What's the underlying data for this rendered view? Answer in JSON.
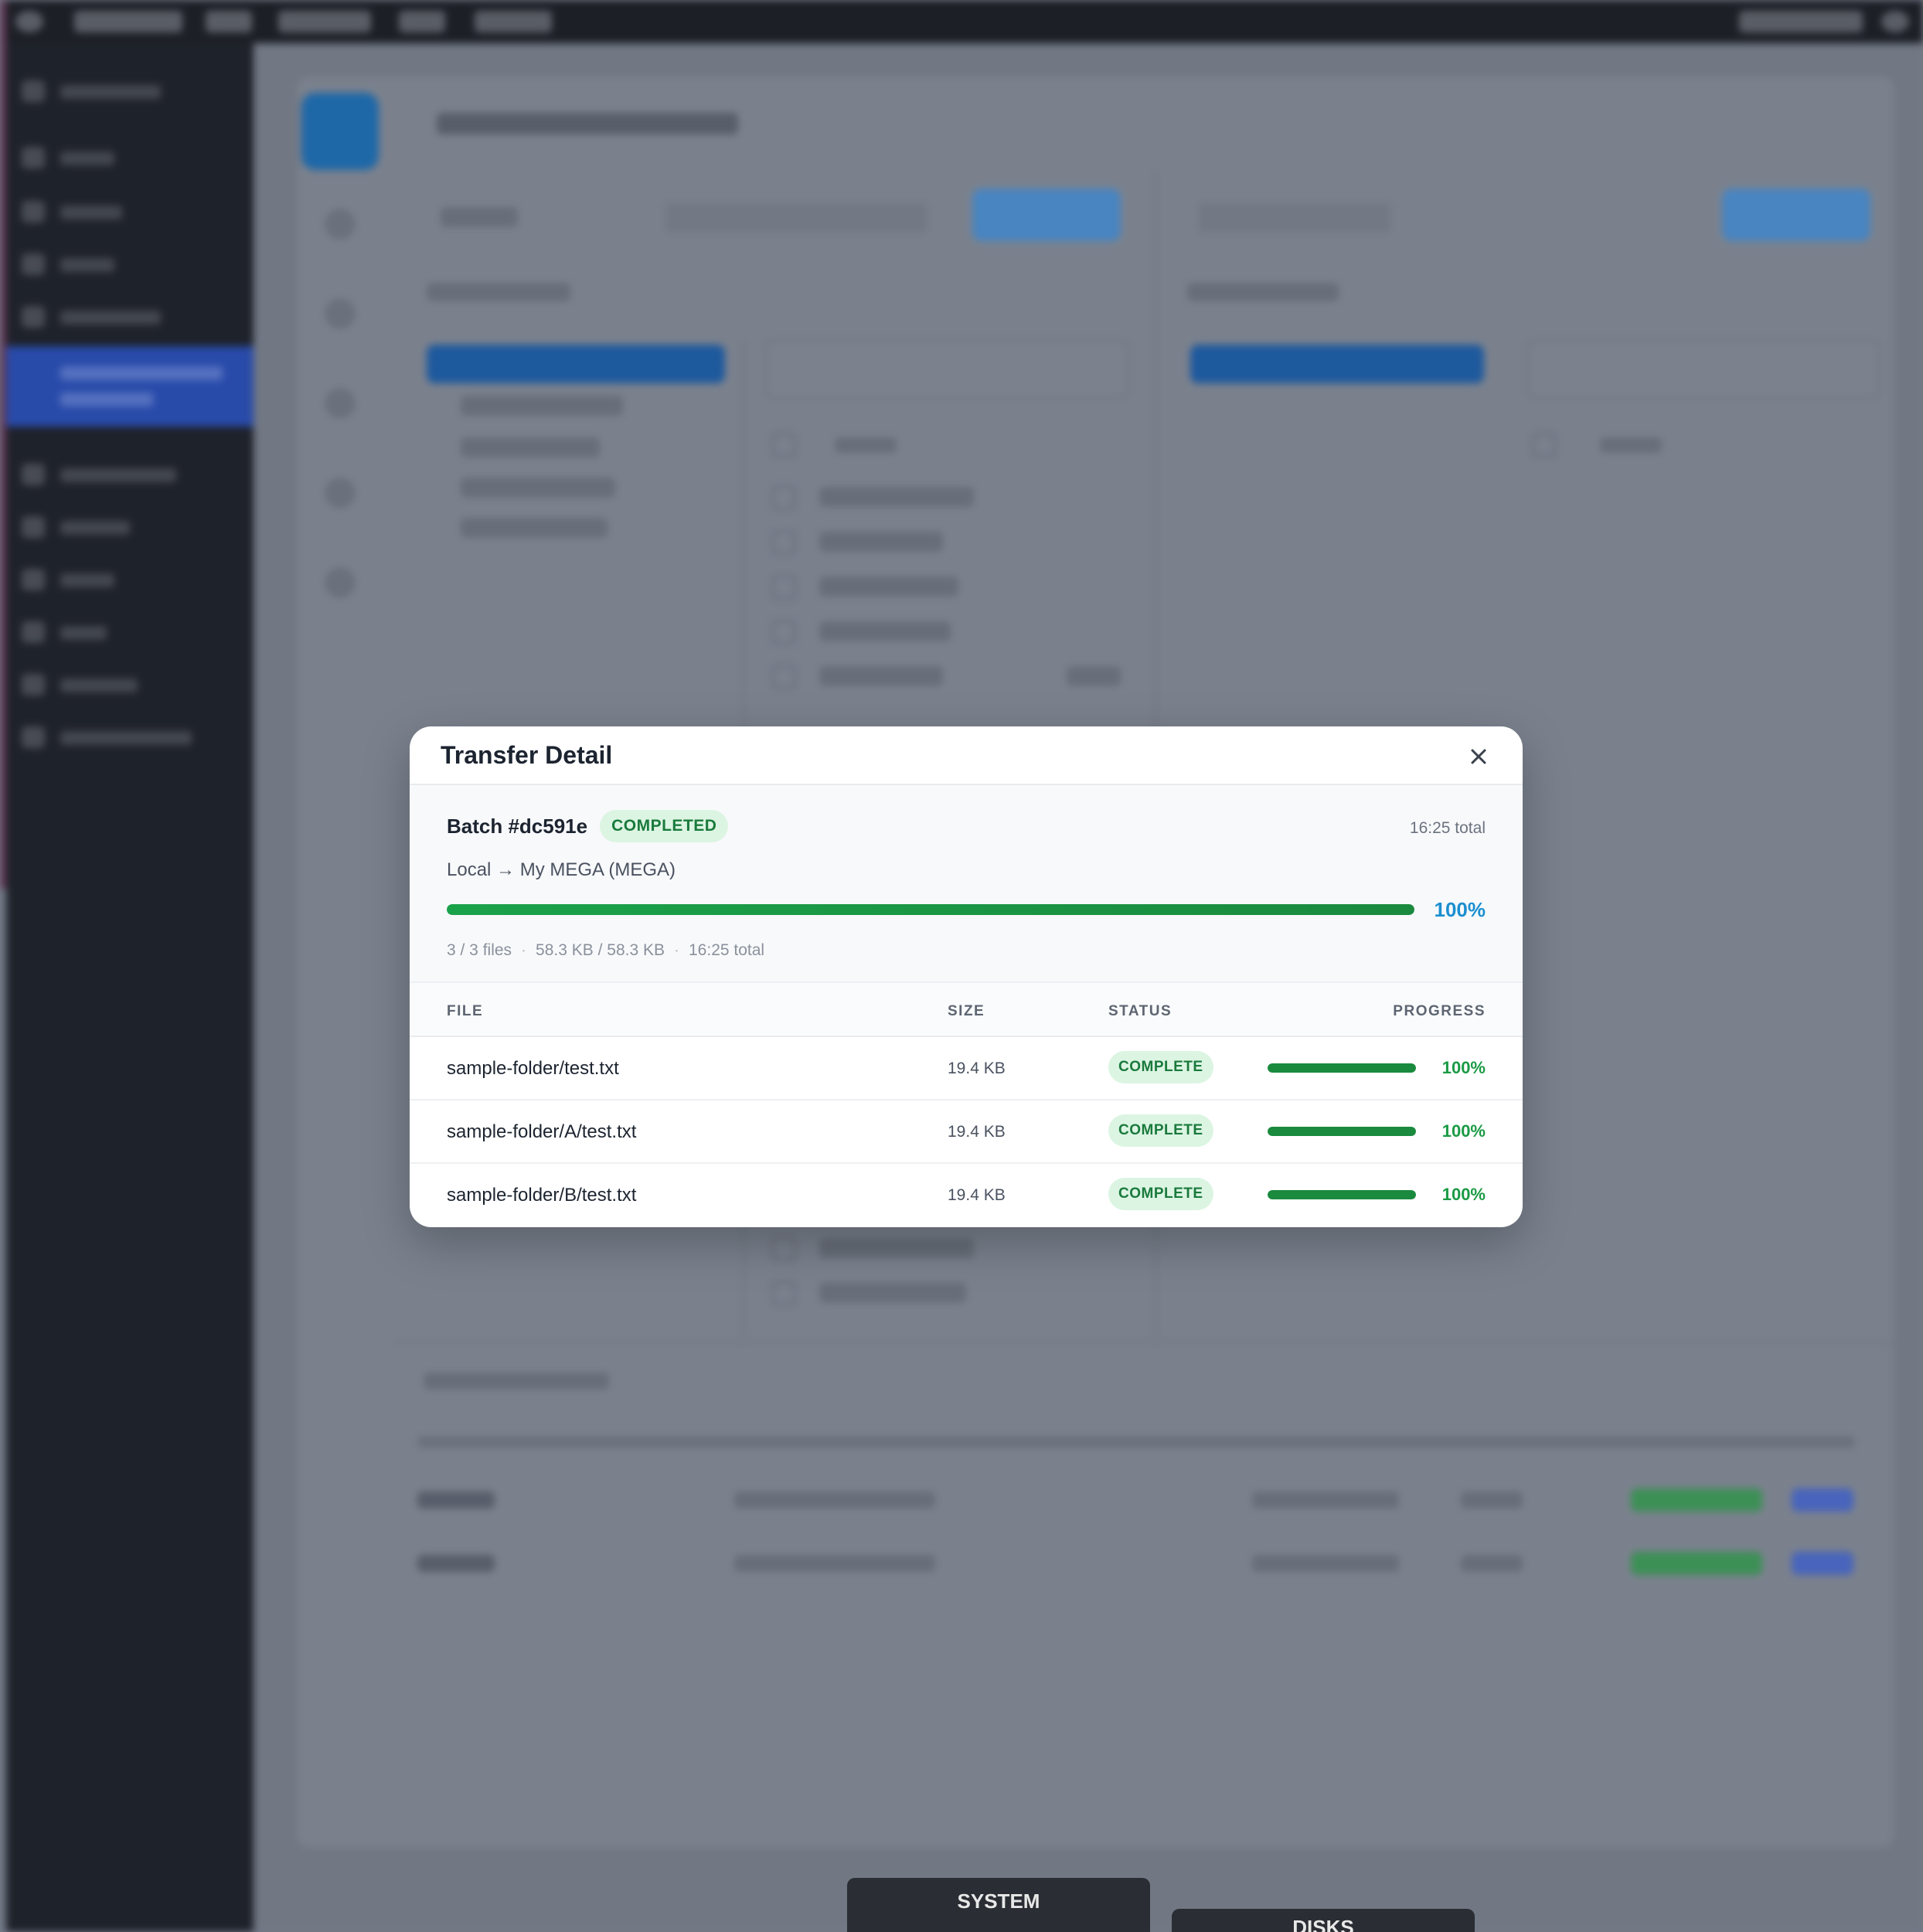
{
  "modal": {
    "title": "Transfer Detail",
    "batch_id": "Batch #dc591e",
    "batch_status": "COMPLETED",
    "total_time": "16:25 total",
    "route": "Local → My MEGA (MEGA)",
    "overall_progress_pct": 100,
    "overall_progress_label": "100%",
    "files_count": "3 / 3 files",
    "bytes": "58.3 KB / 58.3 KB",
    "meta_total": "16:25 total",
    "columns": {
      "file": "FILE",
      "size": "SIZE",
      "status": "STATUS",
      "progress": "PROGRESS"
    },
    "rows": [
      {
        "file": "sample-folder/test.txt",
        "size": "19.4 KB",
        "status": "COMPLETE",
        "progress_pct": 100,
        "progress_label": "100%"
      },
      {
        "file": "sample-folder/A/test.txt",
        "size": "19.4 KB",
        "status": "COMPLETE",
        "progress_pct": 100,
        "progress_label": "100%"
      },
      {
        "file": "sample-folder/B/test.txt",
        "size": "19.4 KB",
        "status": "COMPLETE",
        "progress_pct": 100,
        "progress_label": "100%"
      }
    ]
  },
  "bottom_tabs": {
    "system": "SYSTEM",
    "disks": "DISKS"
  },
  "icons": {
    "close": "close-icon"
  },
  "colors": {
    "accent": "#1b8fd0",
    "success": "#1a8a3e",
    "badge_bg": "#dcf5e3"
  }
}
